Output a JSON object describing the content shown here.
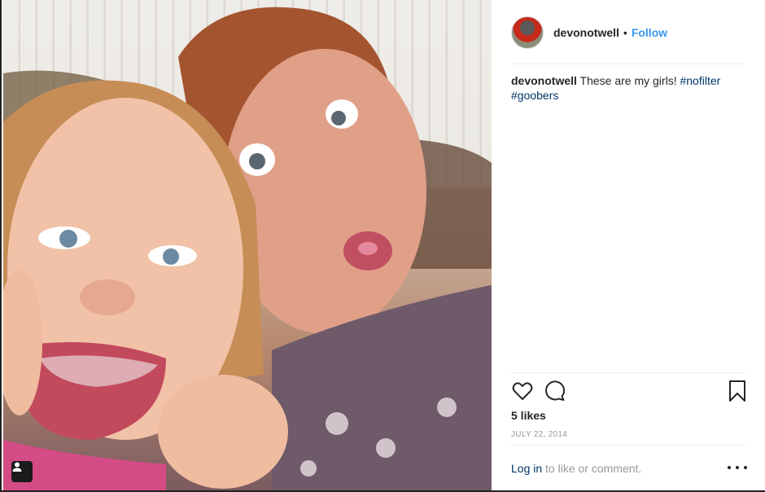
{
  "post": {
    "username": "devonotwell",
    "separator": "•",
    "follow_label": "Follow",
    "caption": {
      "username": "devonotwell",
      "text": "These are my girls!",
      "hashtags": [
        "#nofilter",
        "#goobers"
      ]
    },
    "likes": "5 likes",
    "date": "JULY 22, 2014",
    "login_link": "Log in",
    "login_text": "to like or comment."
  },
  "icons": {
    "avatar": "avatar-image",
    "like": "heart-icon",
    "comment": "comment-bubble-icon",
    "save": "bookmark-icon",
    "more": "more-options-icon",
    "tag": "user-tag-icon"
  },
  "colors": {
    "link_blue": "#3897f0",
    "hashtag": "#003569",
    "muted": "#999999",
    "text": "#262626"
  }
}
